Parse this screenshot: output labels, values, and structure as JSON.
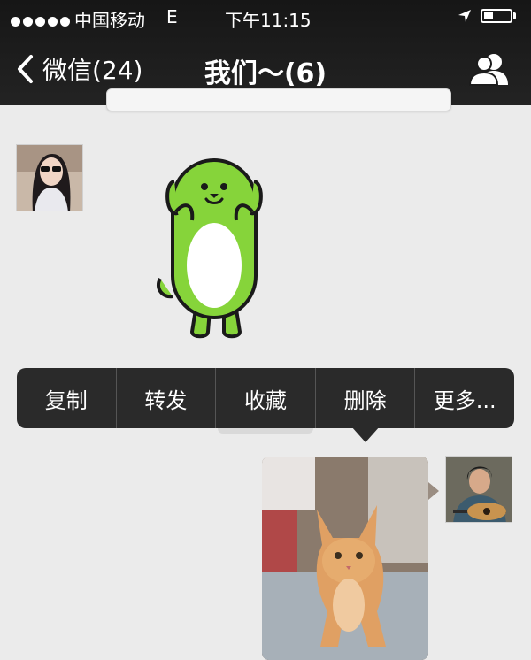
{
  "status_bar": {
    "carrier": "中国移动",
    "network": "E",
    "time": "下午11:15"
  },
  "nav": {
    "back_label": "微信(24)",
    "title": "我们～(6)"
  },
  "context_menu": {
    "items": [
      "复制",
      "转发",
      "收藏",
      "删除",
      "更多..."
    ]
  },
  "icons": {
    "back": "chevron-left-icon",
    "contacts": "group-contacts-icon",
    "location": "location-arrow-icon",
    "battery": "battery-icon"
  },
  "colors": {
    "navbar": "#1c1c1c",
    "chat_background": "#ebebeb",
    "menu_background": "#2a2a2a",
    "sticker_green": "#86d43a"
  }
}
